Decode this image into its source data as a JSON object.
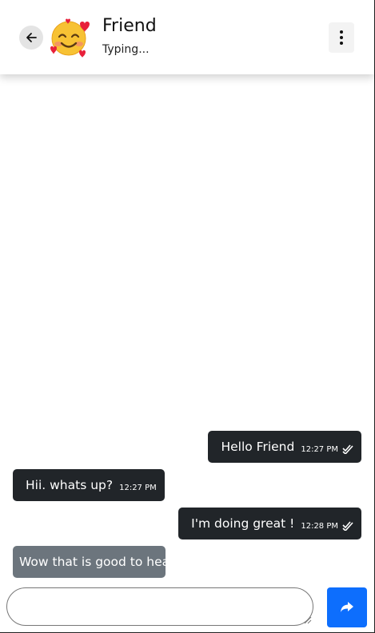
{
  "header": {
    "contact_name": "Friend",
    "status": "Typing...",
    "avatar_icon": "smiling-face-with-hearts-icon"
  },
  "messages": [
    {
      "direction": "sent",
      "text": "Hello Friend",
      "time": "12:27 PM",
      "read": true
    },
    {
      "direction": "received",
      "text": "Hii. whats up?",
      "time": "12:27 PM"
    },
    {
      "direction": "sent",
      "text": "I'm doing great !",
      "time": "12:28 PM",
      "read": true
    },
    {
      "direction": "typing",
      "text": "Wow that is good to hea"
    }
  ],
  "composer": {
    "value": "",
    "send_icon": "share-arrow-icon"
  },
  "colors": {
    "dark_bubble": "#212529",
    "gray_bubble": "#6c757d",
    "send_button": "#0d6efd"
  }
}
